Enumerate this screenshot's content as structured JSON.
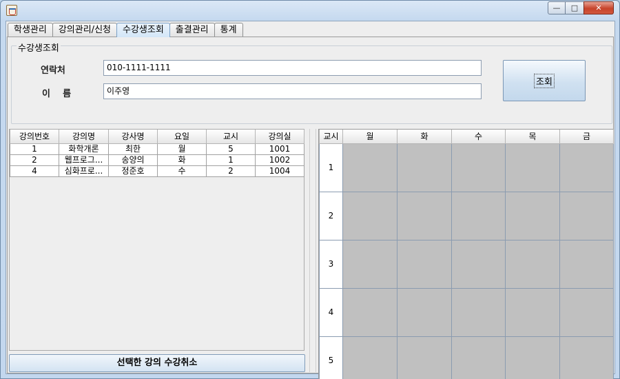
{
  "window": {
    "title": ""
  },
  "tabs": [
    {
      "label": "학생관리"
    },
    {
      "label": "강의관리/신청"
    },
    {
      "label": "수강생조회",
      "active": true
    },
    {
      "label": "출결관리"
    },
    {
      "label": "통계"
    }
  ],
  "search": {
    "group_title": "수강생조회",
    "phone_label": "연락처",
    "phone_value": "010-1111-1111",
    "name_label": "이    름",
    "name_value": "이주영",
    "button_label": "조회"
  },
  "course_table": {
    "columns": [
      "강의번호",
      "강의명",
      "강사명",
      "요일",
      "교시",
      "강의실"
    ],
    "rows": [
      [
        "1",
        "화학개론",
        "최한",
        "월",
        "5",
        "1001"
      ],
      [
        "2",
        "웹프로그...",
        "송양의",
        "화",
        "1",
        "1002"
      ],
      [
        "4",
        "심화프로...",
        "정준호",
        "수",
        "2",
        "1004"
      ]
    ]
  },
  "cancel_button": "선택한 강의 수강취소",
  "timetable": {
    "columns": [
      "교시",
      "월",
      "화",
      "수",
      "목",
      "금"
    ],
    "periods": [
      "1",
      "2",
      "3",
      "4",
      "5"
    ]
  },
  "colors": {
    "slot_fill": "#c0c0c0",
    "active_tab": "#d3e6f7"
  }
}
